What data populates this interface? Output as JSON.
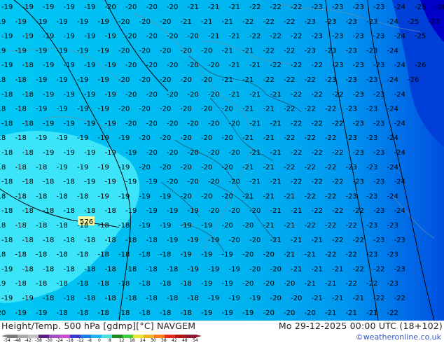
{
  "header": {
    "title": "Height/Temp. 500 hPa [gdmp][°C] NAVGEM",
    "runtime": "Mo 29-12-2025 00:00 UTC (18+102)",
    "credit": "©weatheronline.co.uk"
  },
  "map": {
    "contour_label": "576",
    "temperature_rows": [
      [
        "-19",
        "-19",
        "-19",
        "-19",
        "-19",
        "-20",
        "-20",
        "-20",
        "-20",
        "-21",
        "-21",
        "-21",
        "-22",
        "-22",
        "-22",
        "-23",
        "-23",
        "-23",
        "-23",
        "-24",
        "-25",
        "-26"
      ],
      [
        "-19",
        "-19",
        "-19",
        "-19",
        "-19",
        "-19",
        "-20",
        "-20",
        "-20",
        "-21",
        "-21",
        "-21",
        "-22",
        "-22",
        "-22",
        "-23",
        "-23",
        "-23",
        "-23",
        "-24",
        "-25",
        "-27"
      ],
      [
        "-19",
        "-19",
        "-19",
        "-19",
        "-19",
        "-19",
        "-20",
        "-20",
        "-20",
        "-20",
        "-21",
        "-21",
        "-22",
        "-22",
        "-22",
        "-23",
        "-23",
        "-23",
        "-23",
        "-24",
        "-25"
      ],
      [
        "-19",
        "-19",
        "-19",
        "-19",
        "-19",
        "-19",
        "-20",
        "-20",
        "-20",
        "-20",
        "-20",
        "-21",
        "-21",
        "-22",
        "-22",
        "-23",
        "-23",
        "-23",
        "-23",
        "-24"
      ],
      [
        "-19",
        "-18",
        "-19",
        "-19",
        "-19",
        "-19",
        "-20",
        "-20",
        "-20",
        "-20",
        "-20",
        "-21",
        "-21",
        "-22",
        "-22",
        "-22",
        "-23",
        "-23",
        "-23",
        "-24",
        "-26"
      ],
      [
        "-18",
        "-18",
        "-19",
        "-19",
        "-19",
        "-19",
        "-20",
        "-20",
        "-20",
        "-20",
        "-20",
        "-21",
        "-21",
        "-22",
        "-22",
        "-22",
        "-23",
        "-23",
        "-23",
        "-24",
        "-26"
      ],
      [
        "-18",
        "-18",
        "-19",
        "-19",
        "-19",
        "-19",
        "-20",
        "-20",
        "-20",
        "-20",
        "-20",
        "-21",
        "-21",
        "-21",
        "-22",
        "-22",
        "-22",
        "-23",
        "-23",
        "-24"
      ],
      [
        "-18",
        "-18",
        "-19",
        "-19",
        "-19",
        "-19",
        "-20",
        "-20",
        "-20",
        "-20",
        "-20",
        "-20",
        "-21",
        "-21",
        "-22",
        "-22",
        "-22",
        "-23",
        "-23",
        "-24"
      ],
      [
        "-18",
        "-18",
        "-19",
        "-19",
        "-19",
        "-19",
        "-20",
        "-20",
        "-20",
        "-20",
        "-20",
        "-20",
        "-21",
        "-21",
        "-22",
        "-22",
        "-22",
        "-23",
        "-23",
        "-24"
      ],
      [
        "-18",
        "-18",
        "-19",
        "-19",
        "-19",
        "-19",
        "-19",
        "-20",
        "-20",
        "-20",
        "-20",
        "-20",
        "-21",
        "-21",
        "-22",
        "-22",
        "-22",
        "-23",
        "-23",
        "-24"
      ],
      [
        "-18",
        "-18",
        "-19",
        "-19",
        "-19",
        "-19",
        "-19",
        "-20",
        "-20",
        "-20",
        "-20",
        "-20",
        "-21",
        "-21",
        "-22",
        "-22",
        "-22",
        "-23",
        "-23",
        "-24"
      ],
      [
        "-18",
        "-18",
        "-18",
        "-19",
        "-19",
        "-19",
        "-19",
        "-20",
        "-20",
        "-20",
        "-20",
        "-20",
        "-21",
        "-21",
        "-22",
        "-22",
        "-22",
        "-23",
        "-23",
        "-24"
      ],
      [
        "-18",
        "-18",
        "-18",
        "-18",
        "-19",
        "-19",
        "-19",
        "-19",
        "-20",
        "-20",
        "-20",
        "-20",
        "-21",
        "-21",
        "-22",
        "-22",
        "-22",
        "-23",
        "-23",
        "-24"
      ],
      [
        "-18",
        "-18",
        "-18",
        "-18",
        "-18",
        "-19",
        "-19",
        "-19",
        "-19",
        "-20",
        "-20",
        "-20",
        "-21",
        "-21",
        "-21",
        "-22",
        "-22",
        "-23",
        "-23",
        "-24"
      ],
      [
        "-18",
        "-18",
        "-18",
        "-18",
        "-18",
        "-18",
        "-19",
        "-19",
        "-19",
        "-19",
        "-20",
        "-20",
        "-20",
        "-21",
        "-21",
        "-22",
        "-22",
        "-22",
        "-23",
        "-24"
      ],
      [
        "-18",
        "-18",
        "-18",
        "-18",
        "-18",
        "-18",
        "-18",
        "-19",
        "-19",
        "-19",
        "-19",
        "-20",
        "-20",
        "-21",
        "-21",
        "-22",
        "-22",
        "-22",
        "-23",
        "-23"
      ],
      [
        "-18",
        "-18",
        "-18",
        "-18",
        "-18",
        "-18",
        "-18",
        "-18",
        "-19",
        "-19",
        "-19",
        "-20",
        "-20",
        "-21",
        "-21",
        "-21",
        "-22",
        "-22",
        "-23",
        "-23"
      ],
      [
        "-18",
        "-18",
        "-18",
        "-18",
        "-18",
        "-18",
        "-18",
        "-18",
        "-18",
        "-19",
        "-19",
        "-19",
        "-20",
        "-20",
        "-21",
        "-21",
        "-22",
        "-22",
        "-23",
        "-23"
      ],
      [
        "-19",
        "-18",
        "-18",
        "-18",
        "-18",
        "-18",
        "-18",
        "-18",
        "-18",
        "-19",
        "-19",
        "-19",
        "-20",
        "-20",
        "-21",
        "-21",
        "-21",
        "-22",
        "-22",
        "-23"
      ],
      [
        "-19",
        "-18",
        "-18",
        "-18",
        "-18",
        "-18",
        "-18",
        "-18",
        "-18",
        "-18",
        "-19",
        "-19",
        "-20",
        "-20",
        "-20",
        "-21",
        "-21",
        "-22",
        "-22",
        "-23"
      ],
      [
        "-19",
        "-19",
        "-18",
        "-18",
        "-18",
        "-18",
        "-18",
        "-18",
        "-18",
        "-18",
        "-19",
        "-19",
        "-19",
        "-20",
        "-20",
        "-21",
        "-21",
        "-21",
        "-22",
        "-22"
      ],
      [
        "-20",
        "-19",
        "-19",
        "-18",
        "-18",
        "-18",
        "-18",
        "-18",
        "-18",
        "-18",
        "-19",
        "-19",
        "-19",
        "-20",
        "-20",
        "-20",
        "-21",
        "-21",
        "-21",
        "-22"
      ]
    ]
  },
  "scale": {
    "labels": [
      "-54",
      "-48",
      "-42",
      "-38",
      "-30",
      "-24",
      "-18",
      "-12",
      "-8",
      "0",
      "8",
      "12",
      "18",
      "24",
      "30",
      "38",
      "42",
      "48",
      "54"
    ],
    "colors": [
      "#7a7a7a",
      "#a9a9a9",
      "#c0c0c0",
      "#5a1f78",
      "#a24fbf",
      "#d04ad0",
      "#3a3ad0",
      "#1a7ae8",
      "#1ab6f0",
      "#4adede",
      "#1e8a1e",
      "#3ccf3c",
      "#e6e632",
      "#f0b41e",
      "#ff7a1e",
      "#e82a1e",
      "#b41414",
      "#8c1430"
    ]
  }
}
